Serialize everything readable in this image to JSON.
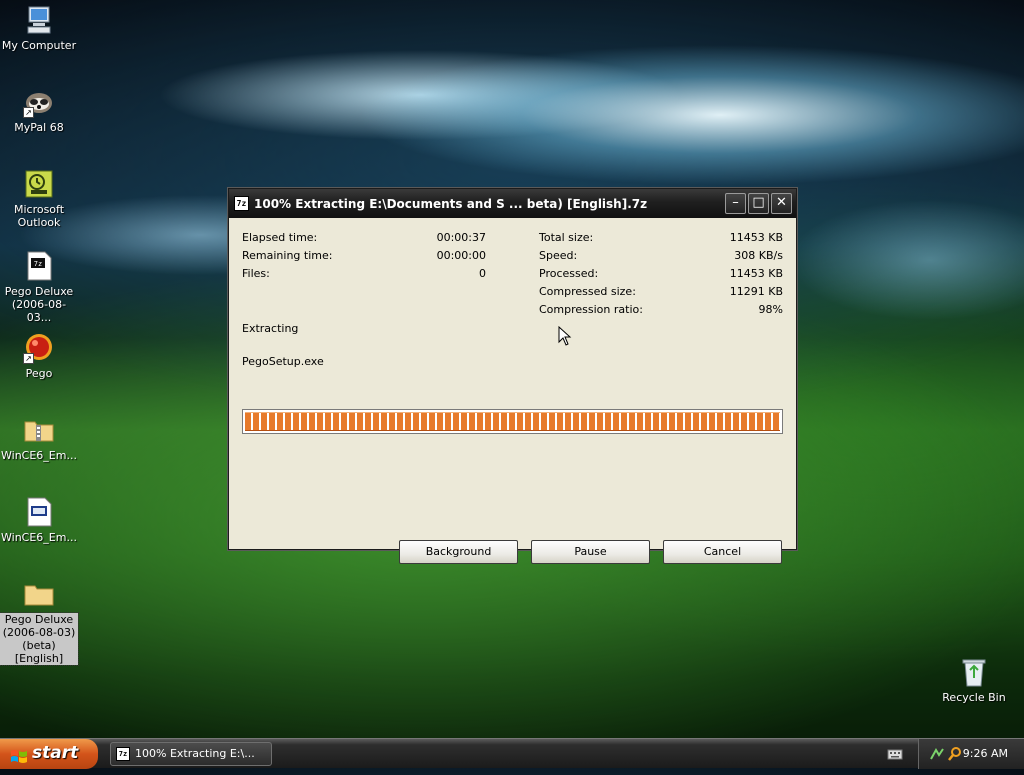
{
  "desktop": {
    "icons": [
      {
        "label": "My Computer"
      },
      {
        "label": "MyPal 68"
      },
      {
        "label": "Microsoft\nOutlook"
      },
      {
        "label": "Pego Deluxe\n(2006-08-03..."
      },
      {
        "label": "Pego"
      },
      {
        "label": "WinCE6_Em..."
      },
      {
        "label": "WinCE6_Em..."
      },
      {
        "label": "Pego Deluxe\n(2006-08-03)\n(beta) [English]"
      },
      {
        "label": "Recycle Bin"
      }
    ]
  },
  "window": {
    "title": "100% Extracting E:\\Documents and S ... beta) [English].7z",
    "icon_text": "7z",
    "controls": {
      "minimize": "–",
      "maximize": "□",
      "close": "✕"
    },
    "stats_left": [
      {
        "label": "Elapsed time:",
        "value": "00:00:37"
      },
      {
        "label": "Remaining time:",
        "value": "00:00:00"
      },
      {
        "label": "Files:",
        "value": "0"
      }
    ],
    "stats_right": [
      {
        "label": "Total size:",
        "value": "11453 KB"
      },
      {
        "label": "Speed:",
        "value": "308 KB/s"
      },
      {
        "label": "Processed:",
        "value": "11453 KB"
      },
      {
        "label": "Compressed size:",
        "value": "11291 KB"
      },
      {
        "label": "Compression ratio:",
        "value": "98%"
      }
    ],
    "status": "Extracting",
    "current_file": "PegoSetup.exe",
    "progress_percent": 100,
    "buttons": {
      "background": "Background",
      "pause": "Pause",
      "cancel": "Cancel"
    }
  },
  "taskbar": {
    "start_label": "start",
    "task_label": "100% Extracting E:\\...",
    "clock": "9:26 AM"
  },
  "colors": {
    "progress": "#e77a2a",
    "start": "#d3541a",
    "window_bg": "#ece9d8"
  }
}
